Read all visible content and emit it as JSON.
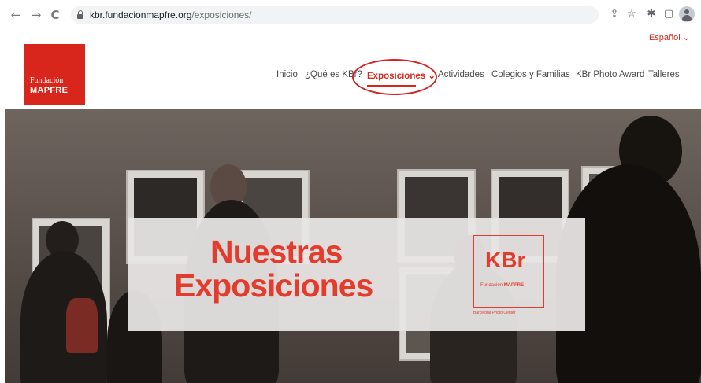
{
  "browser": {
    "url_host": "kbr.fundacionmapfre.org",
    "url_path": "/exposiciones/",
    "back_icon": "←",
    "forward_icon": "→",
    "reload_icon": "C",
    "share_icon": "⇪",
    "star_icon": "☆",
    "extensions_icon": "✱",
    "sidepanel_icon": "▢"
  },
  "site": {
    "language": "Español ⌄",
    "logo_line1": "Fundación",
    "logo_line2": "MAPFRE",
    "nav": {
      "inicio": "Inicio",
      "que_es": "¿Qué es KBr?",
      "exposiciones": "Exposiciones ⌄",
      "actividades": "Actividades",
      "colegios": "Colegios y Familias",
      "photo_award": "KBr Photo Award",
      "talleres": "Talleres"
    }
  },
  "hero": {
    "title_line1": "Nuestras",
    "title_line2": "Exposiciones",
    "kbr_logo": "KBr",
    "kbr_sub_a": "Fundación ",
    "kbr_sub_b": "MAPFRE",
    "kbr_caption": "Barcelona Photo Center"
  },
  "colors": {
    "brand_red": "#d8261c",
    "banner_red": "#e33b2c"
  }
}
